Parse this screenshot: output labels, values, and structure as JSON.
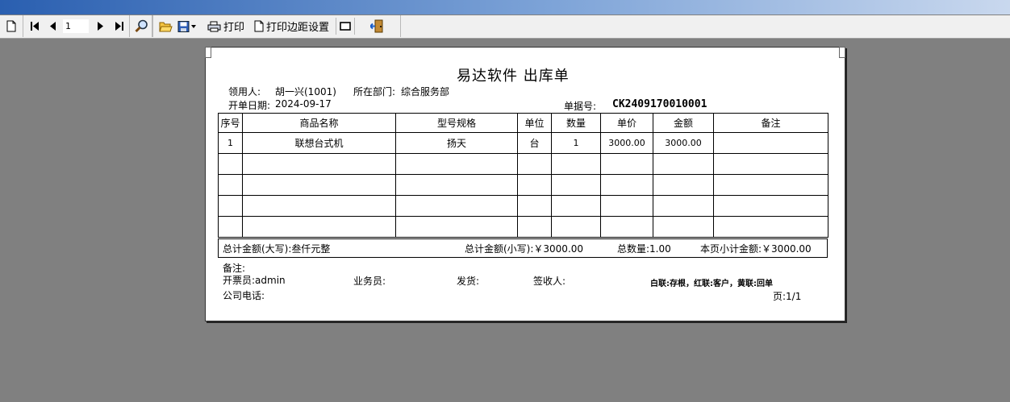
{
  "toolbar": {
    "page_value": "1",
    "print_label": "打印",
    "margin_label": "打印边距设置"
  },
  "doc": {
    "title": "易达软件 出库单",
    "recipient_label": "领用人:",
    "recipient_value": "胡一兴(1001)",
    "dept_label": "所在部门:",
    "dept_value": "综合服务部",
    "date_label": "开单日期:",
    "date_value": "2024-09-17",
    "docno_label": "单据号:",
    "docno_value": "CK2409170010001"
  },
  "table": {
    "headers": [
      "序号",
      "商品名称",
      "型号规格",
      "单位",
      "数量",
      "单价",
      "金额",
      "备注"
    ],
    "rows": [
      {
        "seq": "1",
        "name": "联想台式机",
        "spec": "扬天",
        "unit": "台",
        "qty": "1",
        "price": "3000.00",
        "amount": "3000.00",
        "note": ""
      }
    ]
  },
  "totals": {
    "upper": "总计金额(大写):叁仟元整",
    "lower": "总计金额(小写):￥3000.00",
    "qty": "总数量:1.00",
    "page_sub": "本页小计金额:￥3000.00"
  },
  "footer": {
    "remark": "备注:",
    "issuer": "开票员:admin",
    "salesman": "业务员:",
    "ship": "发货:",
    "sign": "签收人:",
    "copies": "白联:存根，红联:客户，黄联:回单",
    "phone": "公司电话:",
    "page": "页:1/1"
  }
}
